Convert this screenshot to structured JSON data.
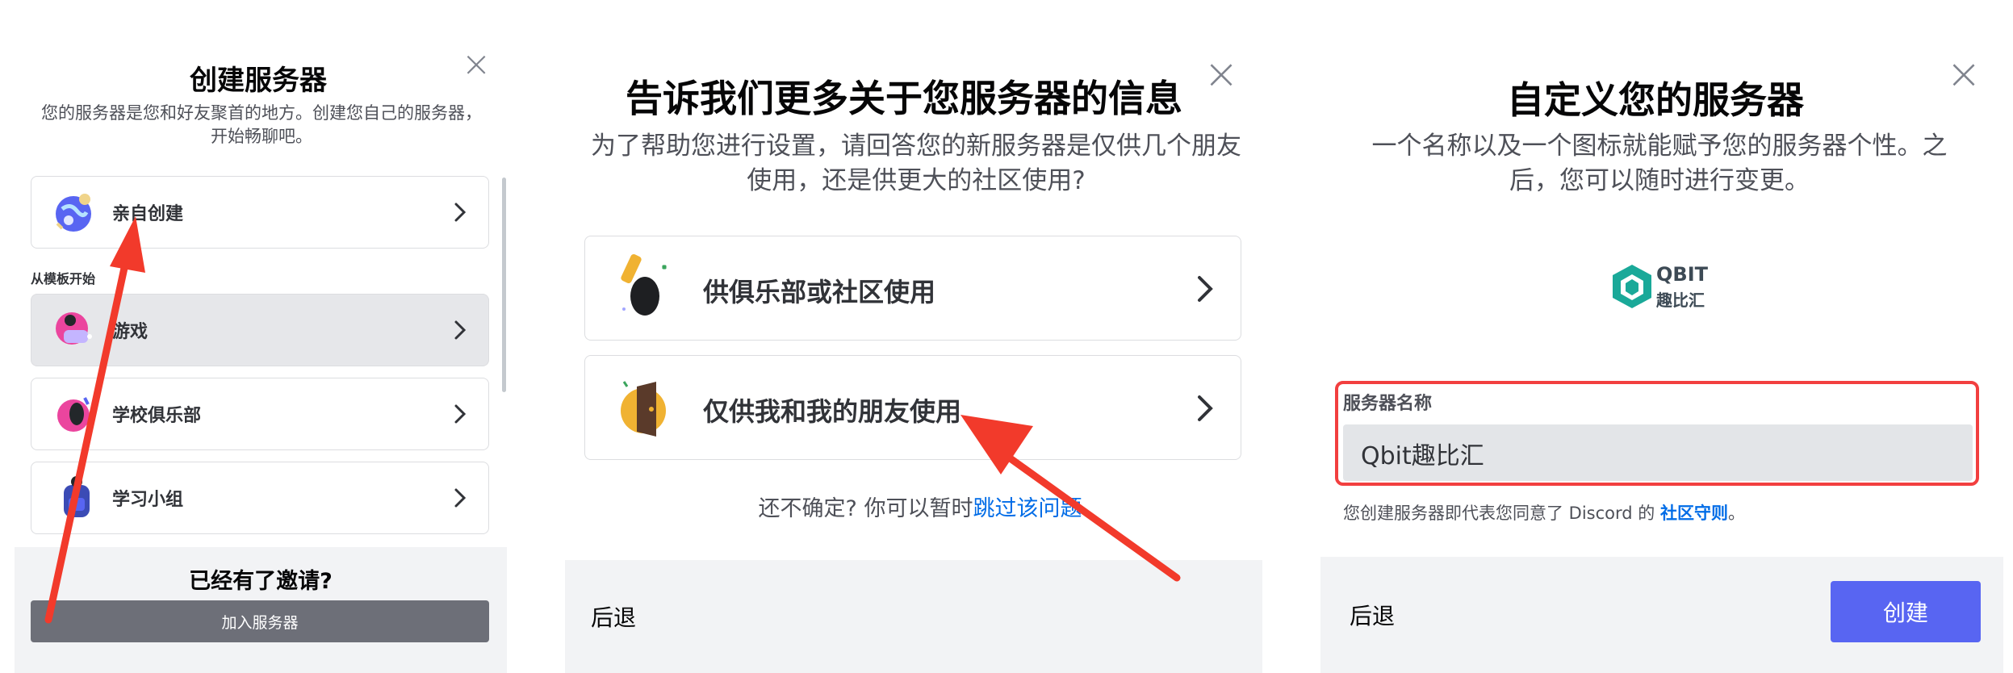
{
  "panel1": {
    "title": "创建服务器",
    "subtitle": "您的服务器是您和好友聚首的地方。创建您自己的服务器，开始畅聊吧。",
    "close": "×",
    "create_own_label": "亲自创建",
    "templates_section": "从模板开始",
    "templates": [
      {
        "label": "游戏"
      },
      {
        "label": "学校俱乐部"
      },
      {
        "label": "学习小组"
      }
    ],
    "invite_heading": "已经有了邀请?",
    "join_button": "加入服务器"
  },
  "panel2": {
    "title": "告诉我们更多关于您服务器的信息",
    "subtitle": "为了帮助您进行设置，请回答您的新服务器是仅供几个朋友使用，还是供更大的社区使用?",
    "close": "×",
    "options": [
      {
        "label": "供俱乐部或社区使用"
      },
      {
        "label": "仅供我和我的朋友使用"
      }
    ],
    "unsure_text": "还不确定? 你可以暂时",
    "skip_link": "跳过该问题",
    "back_button": "后退"
  },
  "panel3": {
    "title": "自定义您的服务器",
    "subtitle": "一个名称以及一个图标就能赋予您的服务器个性。之后，您可以随时进行变更。",
    "close": "×",
    "logo_text_top": "QBIT",
    "logo_text_bottom": "趣比汇",
    "name_label": "服务器名称",
    "name_value": "Qbit趣比汇",
    "terms_prefix": "您创建服务器即代表您同意了 Discord 的 ",
    "terms_link": "社区守则",
    "terms_suffix": "。",
    "back_button": "后退",
    "create_button": "创建"
  },
  "colors": {
    "accent": "#5865f2",
    "highlight_box": "#f23f3f",
    "arrow": "#f23a2b",
    "link": "#006ce7",
    "footer_bg": "#f2f3f5"
  }
}
